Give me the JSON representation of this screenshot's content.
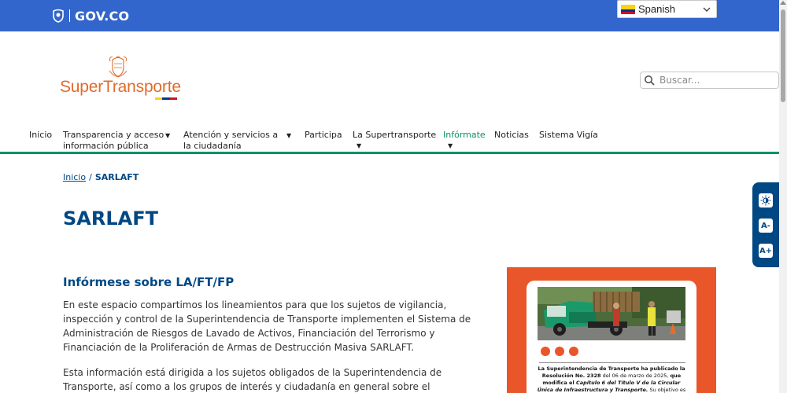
{
  "govbar": {
    "brand": "GOV.CO",
    "language": "Spanish",
    "color": "#3366cc"
  },
  "logo": {
    "text": "SuperTransporte",
    "color": "#e06b2a"
  },
  "search": {
    "placeholder": "Buscar..."
  },
  "nav": {
    "items": [
      {
        "line1": "Inicio",
        "line2": ""
      },
      {
        "line1": "Transparencia y acceso",
        "line2": "información pública"
      },
      {
        "line1": "Atención y servicios a",
        "line2": "la ciudadanía"
      },
      {
        "line1": "Participa",
        "line2": ""
      },
      {
        "line1": "La Supertransporte",
        "line2": ""
      },
      {
        "line1": "Infórmate",
        "line2": ""
      },
      {
        "line1": "Noticias",
        "line2": ""
      },
      {
        "line1": "Sistema Vigía",
        "line2": ""
      }
    ],
    "active_color": "#069169"
  },
  "breadcrumb": {
    "home": "Inicio",
    "separator": "/",
    "current": "SARLAFT"
  },
  "page": {
    "title": "SARLAFT",
    "section_title": "Infórmese sobre LA/FT/FP",
    "para1": "En este espacio compartimos los lineamientos para que los sujetos de vigilancia, inspección y control de la Superintendencia de Transporte implementen el Sistema de Administración de Riesgos de Lavado de Activos, Financiación del Terrorismo y Financiación de la Proliferación de Armas de Destrucción Masiva SARLAFT.",
    "para2": "Esta información está dirigida a los sujetos obligados de la Superintendencia de Transporte, así como a los grupos de interés y ciudadanía en general sobre el",
    "title_color": "#004884"
  },
  "a11y": {
    "contrast": "contrast-icon",
    "decrease": "A-",
    "increase": "A+"
  },
  "promo": {
    "text_part1": "La Superintendencia de Transporte ha publicado la Resolución No. 2328",
    "text_part2": " del 06 de marzo de 2025, ",
    "text_part3": "que modifica el ",
    "text_part4": "Capítulo 6 del Título V de la Circular Única de Infraestructura y Transporte.",
    "text_part5": " Su objetivo es",
    "bg_color": "#e8562a"
  }
}
